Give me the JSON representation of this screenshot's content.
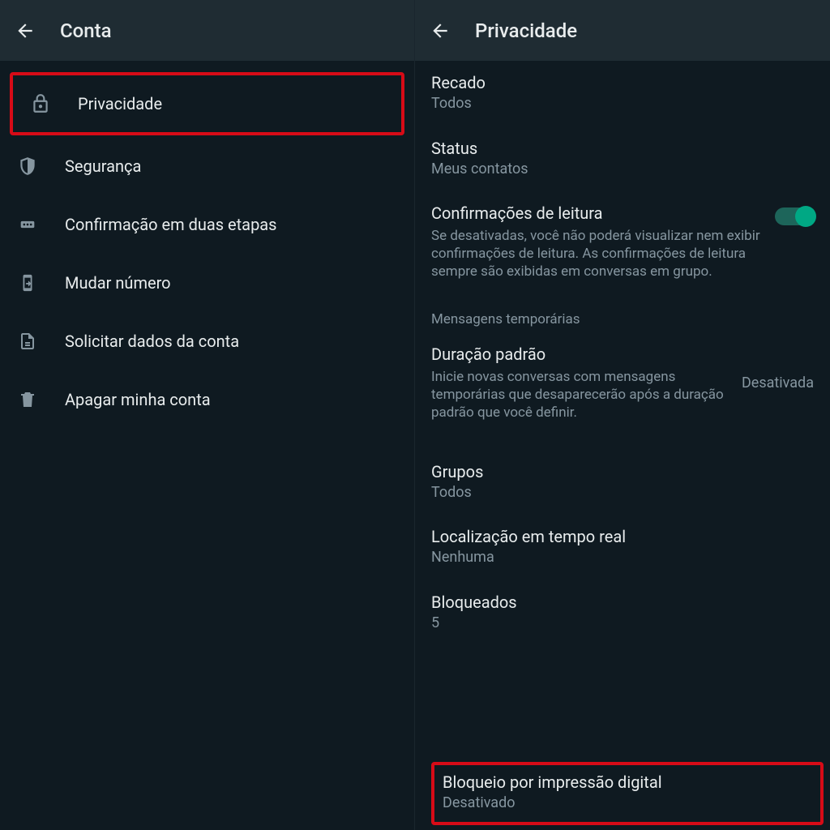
{
  "left": {
    "title": "Conta",
    "items": [
      {
        "icon": "lock",
        "label": "Privacidade"
      },
      {
        "icon": "shield",
        "label": "Segurança"
      },
      {
        "icon": "dots",
        "label": "Confirmação em duas etapas"
      },
      {
        "icon": "sim",
        "label": "Mudar número"
      },
      {
        "icon": "doc",
        "label": "Solicitar dados da conta"
      },
      {
        "icon": "trash",
        "label": "Apagar minha conta"
      }
    ]
  },
  "right": {
    "title": "Privacidade",
    "recado": {
      "title": "Recado",
      "value": "Todos"
    },
    "status": {
      "title": "Status",
      "value": "Meus contatos"
    },
    "read_receipts": {
      "title": "Confirmações de leitura",
      "desc": "Se desativadas, você não poderá visualizar nem exibir confirmações de leitura. As confirmações de leitura sempre são exibidas em conversas em grupo."
    },
    "temp_header": "Mensagens temporárias",
    "default_duration": {
      "title": "Duração padrão",
      "desc": "Inicie novas conversas com mensagens temporárias que desaparecerão após a duração padrão que você definir.",
      "value": "Desativada"
    },
    "groups": {
      "title": "Grupos",
      "value": "Todos"
    },
    "live_location": {
      "title": "Localização em tempo real",
      "value": "Nenhuma"
    },
    "blocked": {
      "title": "Bloqueados",
      "value": "5"
    },
    "fingerprint": {
      "title": "Bloqueio por impressão digital",
      "value": "Desativado"
    }
  }
}
